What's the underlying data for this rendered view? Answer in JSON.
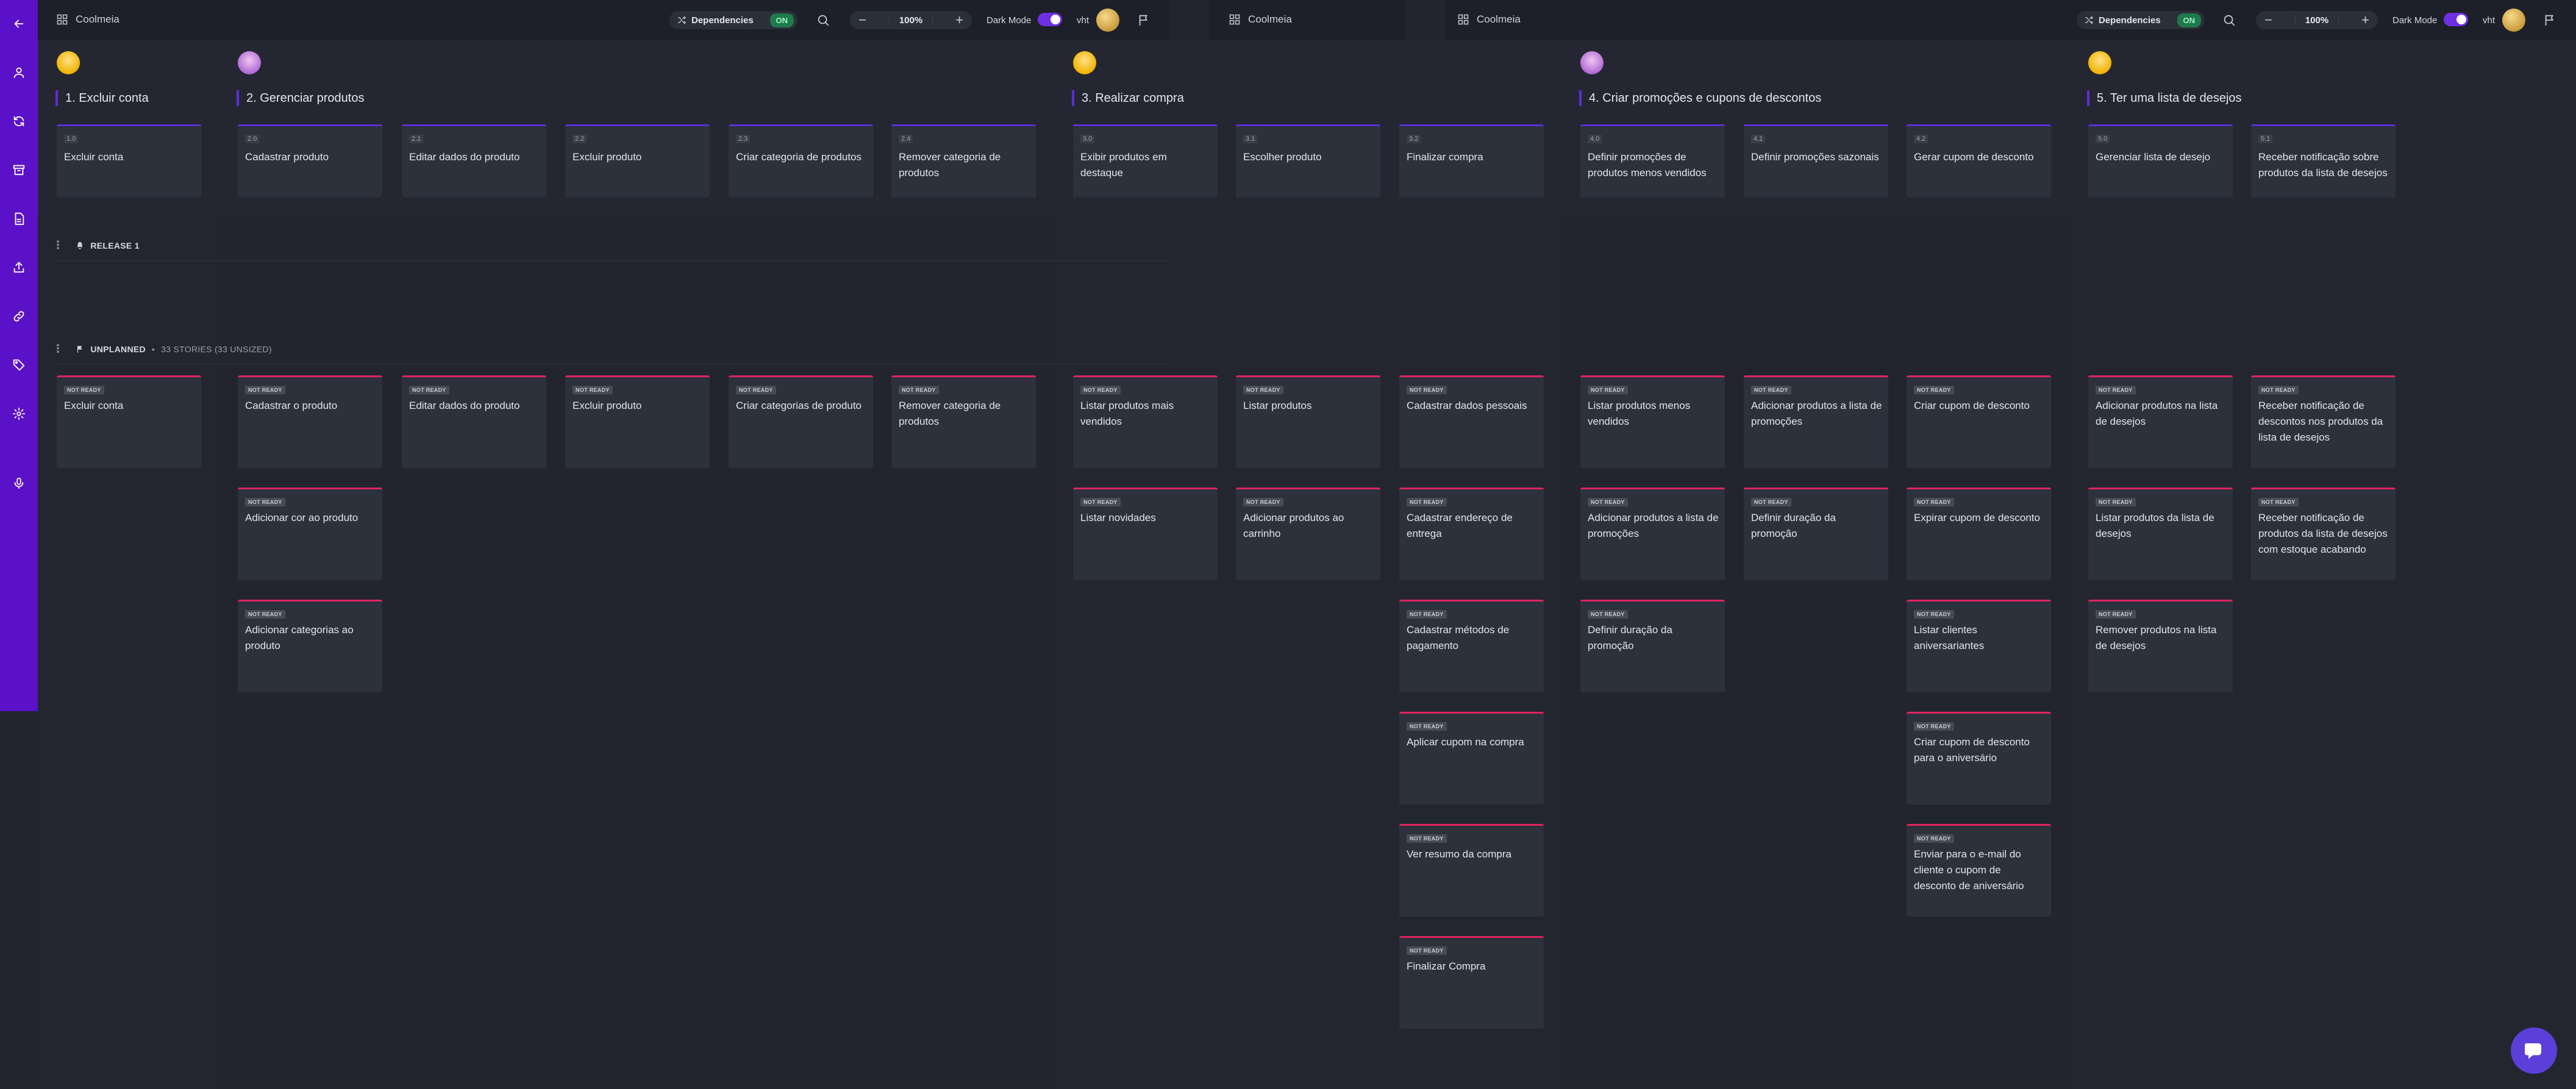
{
  "app": {
    "title": "Coolmeia"
  },
  "toolbar": {
    "dependencies_label": "Dependencies",
    "dependencies_state": "ON",
    "zoom_minus": "−",
    "zoom_value": "100%",
    "zoom_plus": "+",
    "dark_mode_label": "Dark Mode",
    "user_initials": "vht"
  },
  "colors": {
    "sidebar": "#5b11c7",
    "activity_accent": "#5b2fd6",
    "story_accent": "#e0245e",
    "background": "#22252e"
  },
  "sidebar": {
    "icons": [
      "arrow-left-icon",
      "user-icon",
      "refresh-icon",
      "archive-icon",
      "document-icon",
      "upload-icon",
      "link-icon",
      "tag-icon",
      "settings-icon",
      "microphone-icon"
    ]
  },
  "activities": [
    {
      "title": "1. Excluir conta",
      "steps": [
        {
          "num": "1.0",
          "label": "Excluir conta"
        }
      ]
    },
    {
      "title": "2. Gerenciar produtos",
      "steps": [
        {
          "num": "2.0",
          "label": "Cadastrar produto"
        },
        {
          "num": "2.1",
          "label": "Editar dados do produto"
        },
        {
          "num": "2.2",
          "label": "Excluir produto"
        },
        {
          "num": "2.3",
          "label": "Criar categoria de produtos"
        },
        {
          "num": "2.4",
          "label": "Remover categoria de produtos"
        }
      ]
    },
    {
      "title": "3. Realizar compra",
      "steps": [
        {
          "num": "3.0",
          "label": "Exibir produtos em destaque"
        },
        {
          "num": "3.1",
          "label": "Escolher produto"
        },
        {
          "num": "3.2",
          "label": "Finalizar compra"
        }
      ]
    },
    {
      "title": "4. Criar promoções e cupons de descontos",
      "steps": [
        {
          "num": "4.0",
          "label": "Definir promoções de produtos menos vendidos"
        },
        {
          "num": "4.1",
          "label": "Definir promoções sazonais"
        },
        {
          "num": "4.2",
          "label": "Gerar cupom de desconto"
        }
      ]
    },
    {
      "title": "5. Ter uma lista de desejos",
      "steps": [
        {
          "num": "5.0",
          "label": "Gerenciar lista de desejo"
        },
        {
          "num": "5.1",
          "label": "Receber notificação sobre produtos da lista de desejos"
        }
      ]
    }
  ],
  "releases": {
    "release1": {
      "label": "RELEASE 1"
    },
    "unplanned": {
      "label": "UNPLANNED",
      "count": "33 STORIES (33 UNSIZED)"
    }
  },
  "story_badge": "NOT READY",
  "story_columns": [
    [
      "Excluir conta"
    ],
    [
      "Cadastrar o produto",
      "Adicionar cor ao produto",
      "Adicionar categorias ao produto"
    ],
    [
      "Editar dados do produto"
    ],
    [
      "Excluir produto"
    ],
    [
      "Criar categorias de produto"
    ],
    [
      "Remover categoria de produtos"
    ],
    [
      "Listar produtos mais vendidos",
      "Listar novidades"
    ],
    [
      "Listar produtos",
      "Adicionar produtos ao carrinho"
    ],
    [
      "Cadastrar dados pessoais",
      "Cadastrar endereço de entrega",
      "Cadastrar métodos de pagamento",
      "Aplicar cupom na compra",
      "Ver resumo da compra",
      "Finalizar Compra"
    ],
    [
      "Listar produtos menos vendidos",
      "Adicionar produtos a lista de promoções",
      "Definir duração da promoção"
    ],
    [
      "Adicionar produtos a lista de promoções",
      "Definir duração da promoção"
    ],
    [
      "Criar cupom de desconto",
      "Expirar cupom de desconto",
      "Listar clientes aniversariantes",
      "Criar cupom de desconto para o aniversário",
      "Enviar para o e-mail do cliente o cupom de desconto de aniversário"
    ],
    [
      "Adicionar produtos na lista de desejos",
      "Listar produtos da lista de desejos",
      "Remover produtos na lista de desejos"
    ],
    [
      "Receber notificação de descontos nos produtos da lista de desejos",
      "Receber notificação de produtos da lista de desejos com estoque acabando"
    ]
  ]
}
